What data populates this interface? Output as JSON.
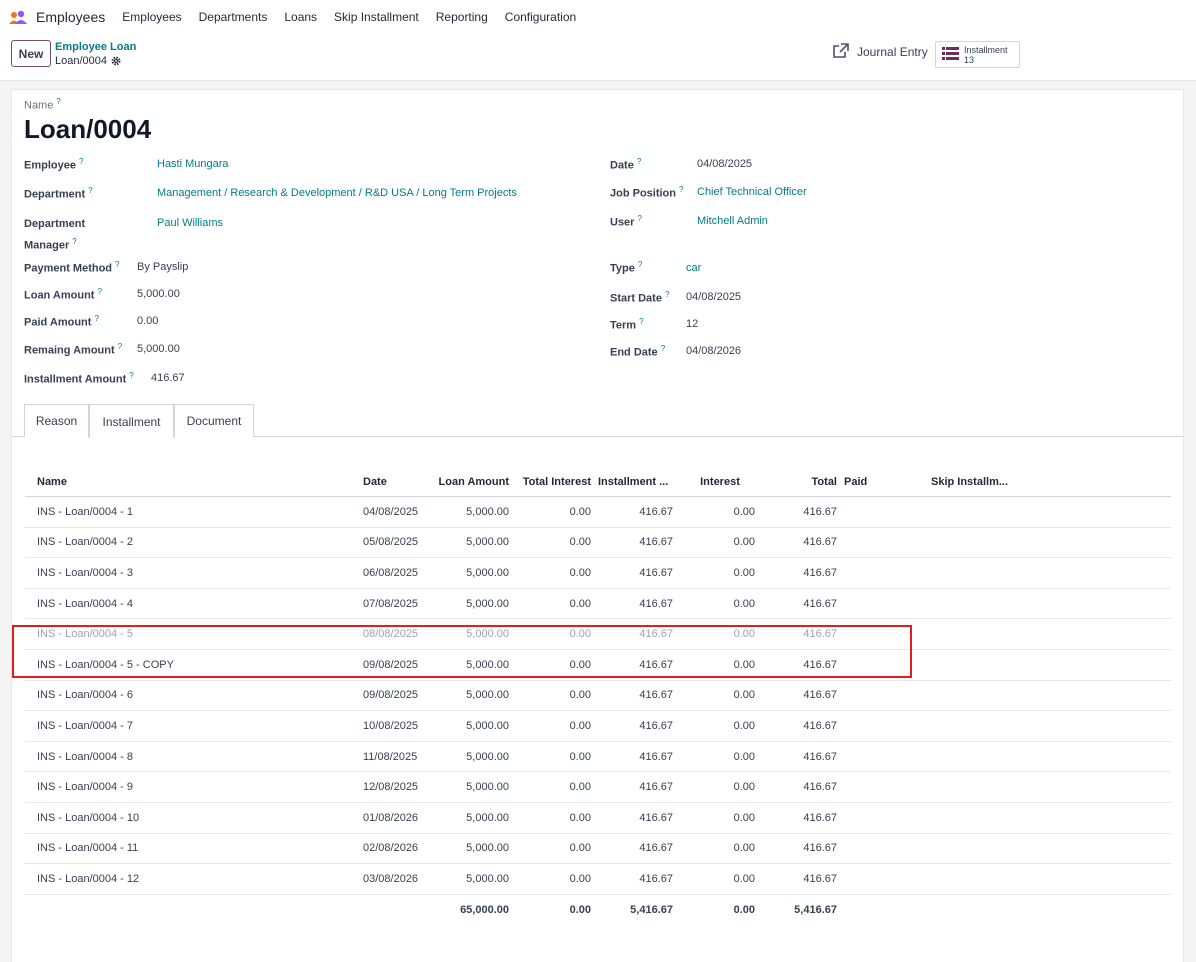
{
  "navbar": {
    "app_name": "Employees",
    "items": [
      "Employees",
      "Departments",
      "Loans",
      "Skip Installment",
      "Reporting",
      "Configuration"
    ]
  },
  "control": {
    "new_label": "New",
    "breadcrumb_parent": "Employee Loan",
    "breadcrumb_current": "Loan/0004",
    "journal_label": "Journal Entry",
    "installment_label": "Installment",
    "installment_count": "13"
  },
  "form": {
    "name_label": "Name",
    "title": "Loan/0004",
    "left": {
      "employee_label": "Employee",
      "employee": "Hasti Mungara",
      "department_label": "Department",
      "department": "Management / Research & Development / R&D USA / Long Term Projects",
      "manager_label_1": "Department",
      "manager_label_2": "Manager",
      "manager": "Paul Williams",
      "payment_method_label": "Payment Method",
      "payment_method": "By Payslip",
      "loan_amount_label": "Loan Amount",
      "loan_amount": "5,000.00",
      "paid_amount_label": "Paid Amount",
      "paid_amount": "0.00",
      "remaining_label": "Remaing Amount",
      "remaining": "5,000.00",
      "installment_amount_label": "Installment Amount",
      "installment_amount": "416.67"
    },
    "right": {
      "date_label": "Date",
      "date": "04/08/2025",
      "job_label": "Job Position",
      "job": "Chief Technical Officer",
      "user_label": "User",
      "user": "Mitchell Admin",
      "type_label": "Type",
      "type": "car",
      "start_label": "Start Date",
      "start": "04/08/2025",
      "term_label": "Term",
      "term": "12",
      "end_label": "End Date",
      "end": "04/08/2026"
    },
    "help_mark": "?"
  },
  "tabs": [
    "Reason",
    "Installment",
    "Document"
  ],
  "table": {
    "headers": {
      "name": "Name",
      "date": "Date",
      "loan": "Loan Amount",
      "tint": "Total Interest",
      "inst": "Installment ...",
      "int": "Interest",
      "tot": "Total",
      "paid": "Paid",
      "skip": "Skip Installm..."
    },
    "rows": [
      {
        "name": "INS - Loan/0004 - 1",
        "date": "04/08/2025",
        "loan": "5,000.00",
        "tint": "0.00",
        "inst": "416.67",
        "int": "0.00",
        "tot": "416.67"
      },
      {
        "name": "INS - Loan/0004 - 2",
        "date": "05/08/2025",
        "loan": "5,000.00",
        "tint": "0.00",
        "inst": "416.67",
        "int": "0.00",
        "tot": "416.67"
      },
      {
        "name": "INS - Loan/0004 - 3",
        "date": "06/08/2025",
        "loan": "5,000.00",
        "tint": "0.00",
        "inst": "416.67",
        "int": "0.00",
        "tot": "416.67"
      },
      {
        "name": "INS - Loan/0004 - 4",
        "date": "07/08/2025",
        "loan": "5,000.00",
        "tint": "0.00",
        "inst": "416.67",
        "int": "0.00",
        "tot": "416.67"
      },
      {
        "name": "INS - Loan/0004 - 5",
        "date": "08/08/2025",
        "loan": "5,000.00",
        "tint": "0.00",
        "inst": "416.67",
        "int": "0.00",
        "tot": "416.67",
        "muted": true
      },
      {
        "name": "INS - Loan/0004 - 5 - COPY",
        "date": "09/08/2025",
        "loan": "5,000.00",
        "tint": "0.00",
        "inst": "416.67",
        "int": "0.00",
        "tot": "416.67"
      },
      {
        "name": "INS - Loan/0004 - 6",
        "date": "09/08/2025",
        "loan": "5,000.00",
        "tint": "0.00",
        "inst": "416.67",
        "int": "0.00",
        "tot": "416.67"
      },
      {
        "name": "INS - Loan/0004 - 7",
        "date": "10/08/2025",
        "loan": "5,000.00",
        "tint": "0.00",
        "inst": "416.67",
        "int": "0.00",
        "tot": "416.67"
      },
      {
        "name": "INS - Loan/0004 - 8",
        "date": "11/08/2025",
        "loan": "5,000.00",
        "tint": "0.00",
        "inst": "416.67",
        "int": "0.00",
        "tot": "416.67"
      },
      {
        "name": "INS - Loan/0004 - 9",
        "date": "12/08/2025",
        "loan": "5,000.00",
        "tint": "0.00",
        "inst": "416.67",
        "int": "0.00",
        "tot": "416.67"
      },
      {
        "name": "INS - Loan/0004 - 10",
        "date": "01/08/2026",
        "loan": "5,000.00",
        "tint": "0.00",
        "inst": "416.67",
        "int": "0.00",
        "tot": "416.67"
      },
      {
        "name": "INS - Loan/0004 - 11",
        "date": "02/08/2026",
        "loan": "5,000.00",
        "tint": "0.00",
        "inst": "416.67",
        "int": "0.00",
        "tot": "416.67"
      },
      {
        "name": "INS - Loan/0004 - 12",
        "date": "03/08/2026",
        "loan": "5,000.00",
        "tint": "0.00",
        "inst": "416.67",
        "int": "0.00",
        "tot": "416.67"
      }
    ],
    "footer": {
      "loan": "65,000.00",
      "tint": "0.00",
      "inst": "5,416.67",
      "int": "0.00",
      "tot": "5,416.67"
    }
  },
  "colors": {
    "accent": "#017e84",
    "brand": "#714b67",
    "highlight": "#e11d1d"
  }
}
